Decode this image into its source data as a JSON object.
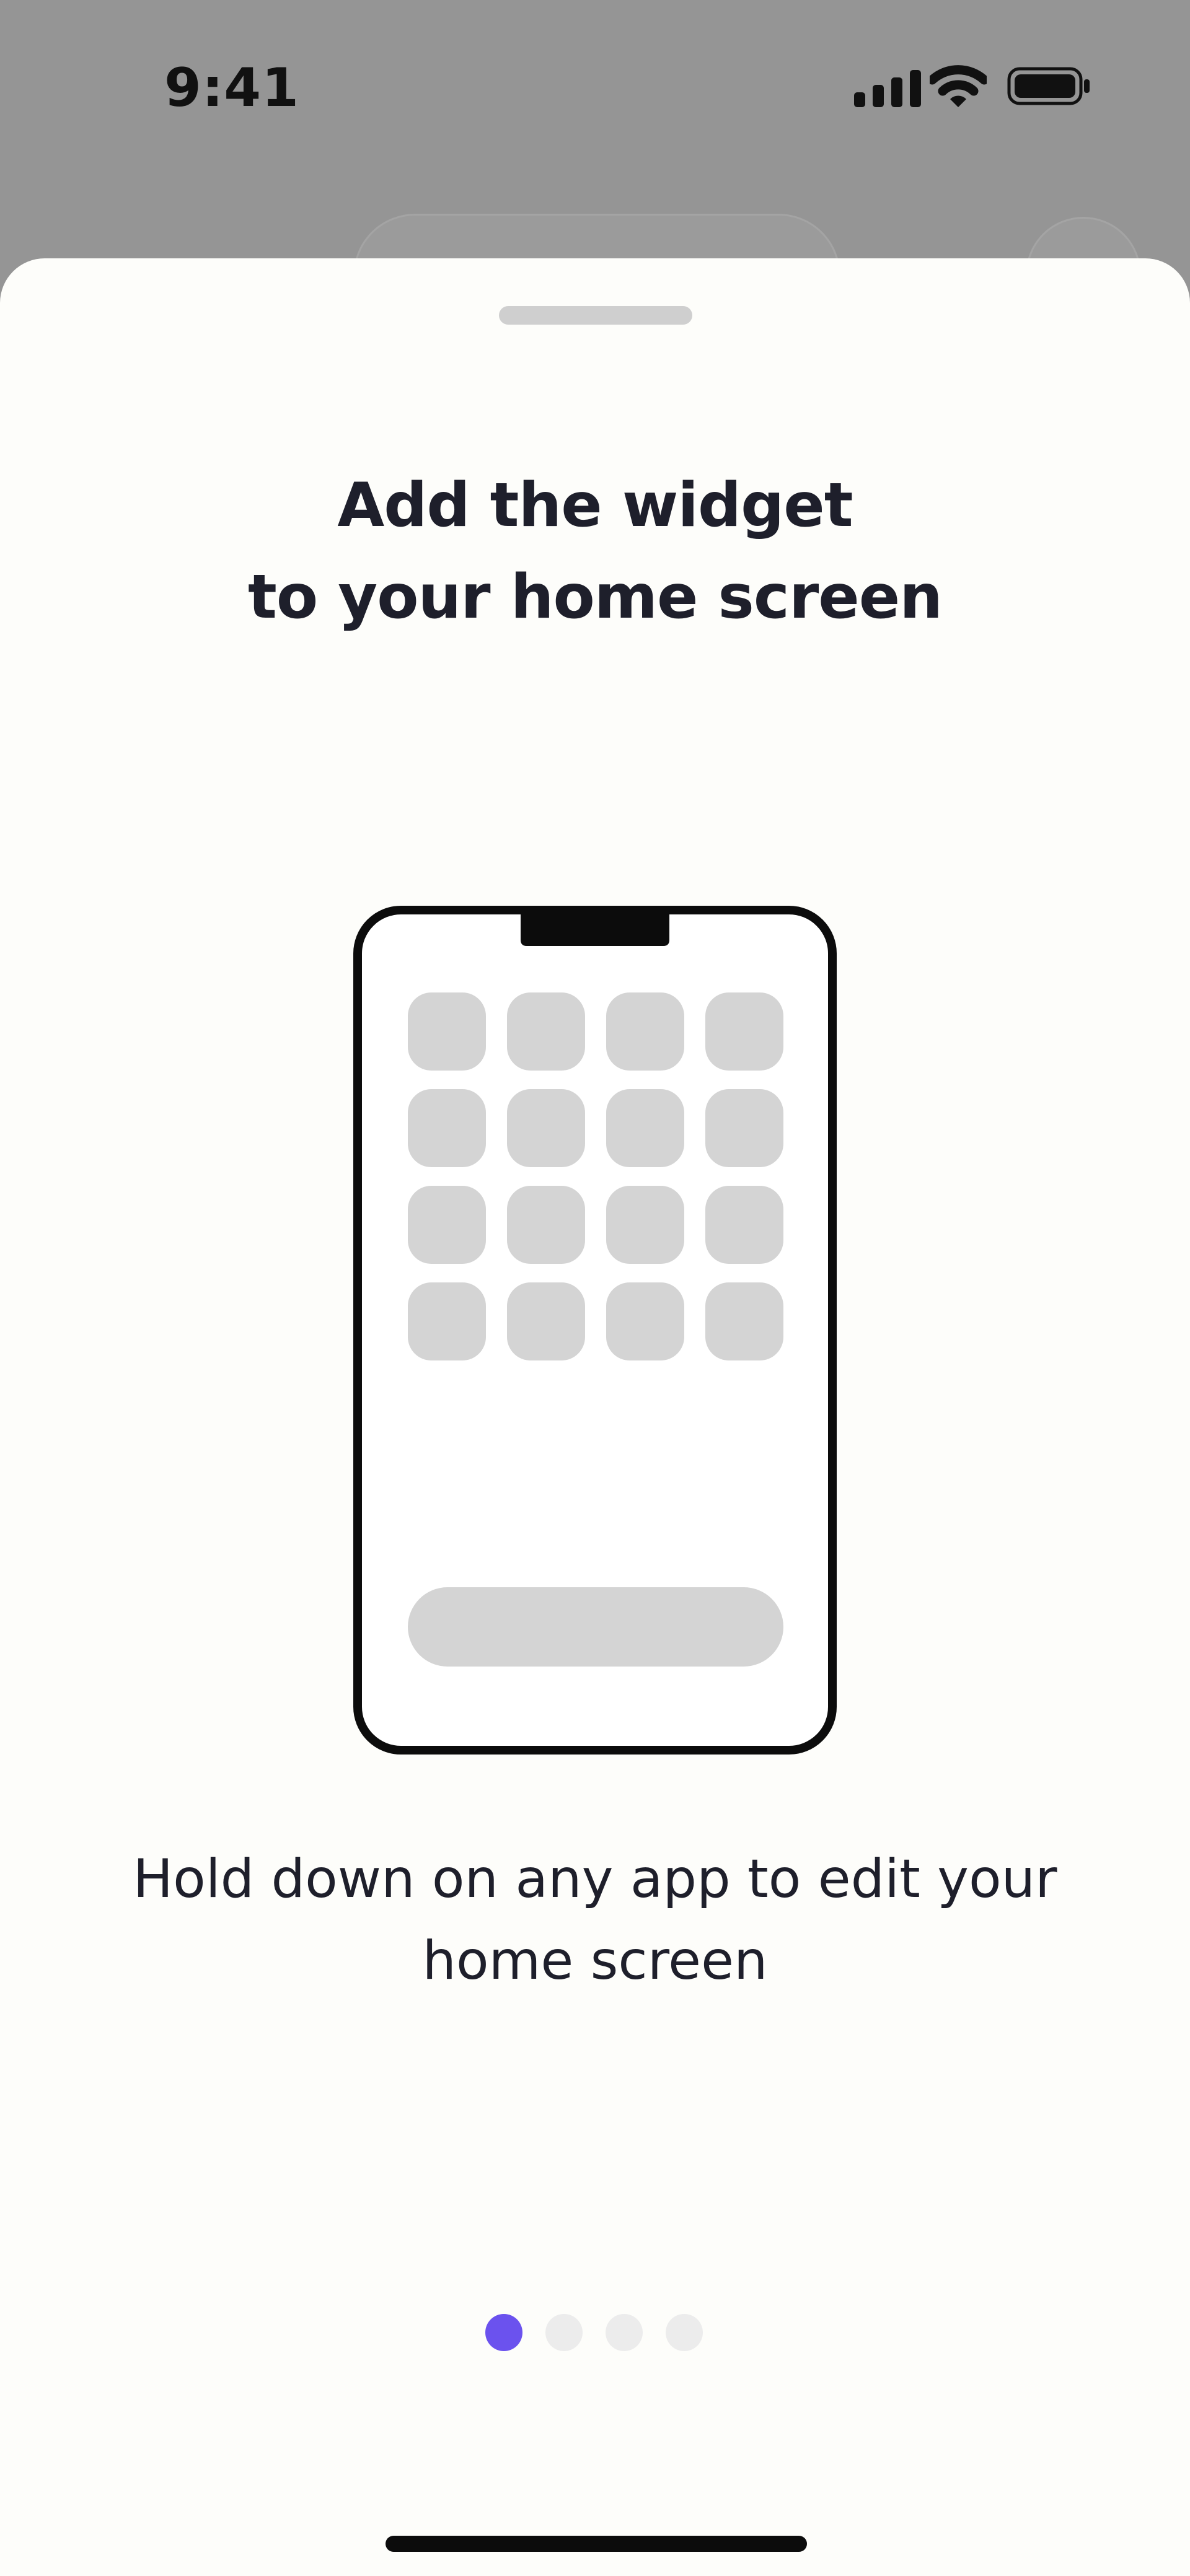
{
  "status_bar": {
    "time": "9:41",
    "signal_icon": "cellular-signal-icon",
    "wifi_icon": "wifi-icon",
    "battery_icon": "battery-icon"
  },
  "sheet": {
    "title": "Add the widget\nto your home screen",
    "description": "Hold down on any app to edit your\nhome screen",
    "illustration": "phone-home-screen-illustration",
    "pages": {
      "total": 4,
      "current": 1
    }
  },
  "colors": {
    "accent": "#6b52ee",
    "text": "#1e1f2b",
    "sheet_background": "#fdfdfa",
    "dimmed_background": "#959595",
    "placeholder": "#d4d4d4"
  }
}
